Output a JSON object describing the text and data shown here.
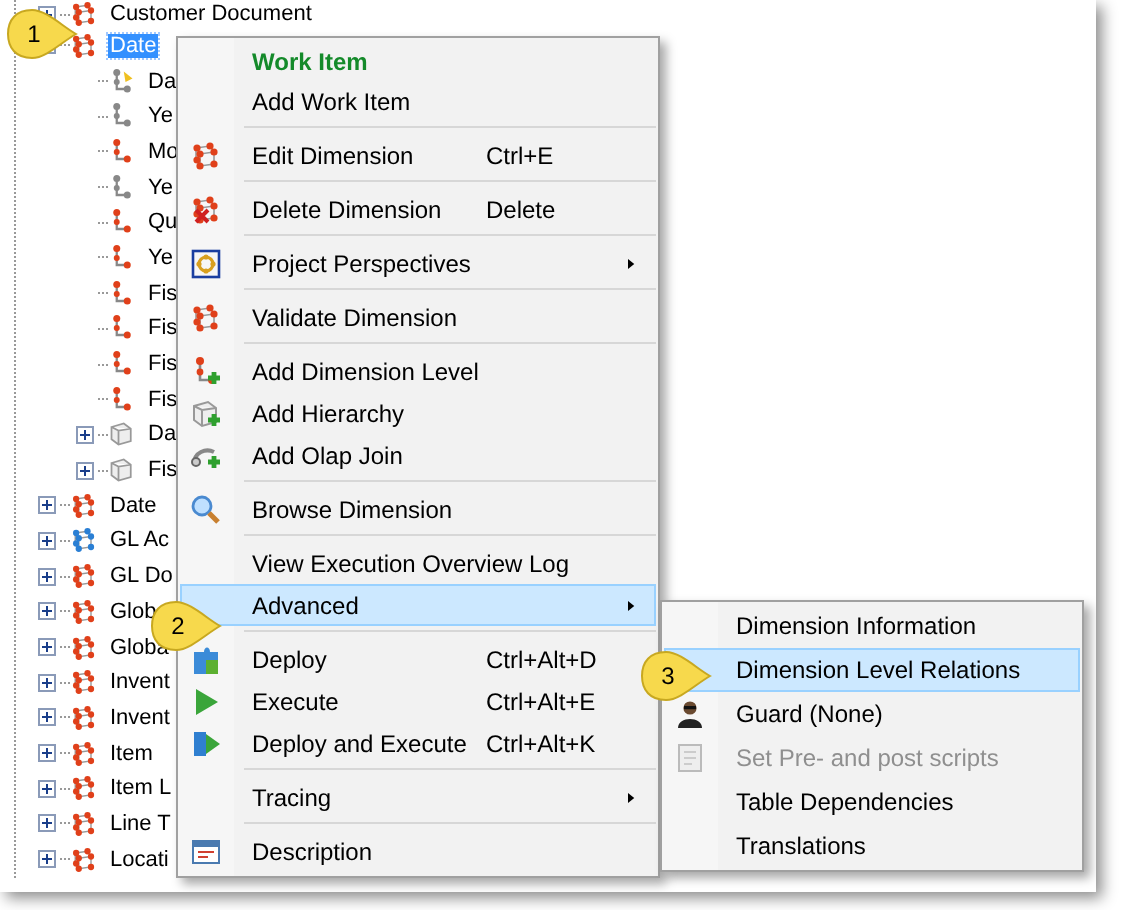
{
  "tree": [
    {
      "label": "Customer Document",
      "kind": "dimension",
      "expanded": false,
      "selected": false
    },
    {
      "label": "Date",
      "kind": "dimension",
      "expanded": true,
      "selected": true,
      "children": [
        {
          "label": "Da",
          "kind": "key-level",
          "expanded": false,
          "selected": false
        },
        {
          "label": "Ye",
          "kind": "grey-level",
          "expanded": false,
          "selected": false
        },
        {
          "label": "Mo",
          "kind": "level",
          "expanded": false,
          "selected": false
        },
        {
          "label": "Ye",
          "kind": "grey-level",
          "expanded": false,
          "selected": false
        },
        {
          "label": "Qu",
          "kind": "level",
          "expanded": false,
          "selected": false
        },
        {
          "label": "Ye",
          "kind": "level",
          "expanded": false,
          "selected": false
        },
        {
          "label": "Fis",
          "kind": "level",
          "expanded": false,
          "selected": false
        },
        {
          "label": "Fis",
          "kind": "level",
          "expanded": false,
          "selected": false
        },
        {
          "label": "Fis",
          "kind": "level",
          "expanded": false,
          "selected": false
        },
        {
          "label": "Fis",
          "kind": "level",
          "expanded": false,
          "selected": false
        },
        {
          "label": "Da",
          "kind": "hierarchy",
          "expanded": false,
          "selected": false
        },
        {
          "label": "Fis",
          "kind": "hierarchy",
          "expanded": false,
          "selected": false
        }
      ]
    },
    {
      "label": "Date",
      "kind": "dimension",
      "expanded": false,
      "selected": false
    },
    {
      "label": "GL Ac",
      "kind": "linked-dimension",
      "expanded": false,
      "selected": false
    },
    {
      "label": "GL Do",
      "kind": "dimension",
      "expanded": false,
      "selected": false
    },
    {
      "label": "Glob",
      "kind": "dimension",
      "expanded": false,
      "selected": false
    },
    {
      "label": "Globa",
      "kind": "dimension",
      "expanded": false,
      "selected": false
    },
    {
      "label": "Invent",
      "kind": "dimension",
      "expanded": false,
      "selected": false
    },
    {
      "label": "Invent",
      "kind": "dimension",
      "expanded": false,
      "selected": false
    },
    {
      "label": "Item",
      "kind": "dimension",
      "expanded": false,
      "selected": false
    },
    {
      "label": "Item L",
      "kind": "dimension",
      "expanded": false,
      "selected": false
    },
    {
      "label": "Line T",
      "kind": "dimension",
      "expanded": false,
      "selected": false
    },
    {
      "label": "Locati",
      "kind": "dimension",
      "expanded": false,
      "selected": false
    }
  ],
  "context_menu": {
    "groups": [
      [
        {
          "label": "Work Item",
          "kind": "header",
          "selected": false,
          "has_submenu": false
        },
        {
          "label": "Add Work Item",
          "kind": "item",
          "selected": false,
          "has_submenu": false
        }
      ],
      [
        {
          "label": "Edit Dimension",
          "shortcut": "Ctrl+E",
          "kind": "item",
          "selected": false,
          "has_submenu": false
        }
      ],
      [
        {
          "label": "Delete Dimension",
          "shortcut": "Delete",
          "kind": "item",
          "selected": false,
          "has_submenu": false
        }
      ],
      [
        {
          "label": "Project Perspectives",
          "kind": "item",
          "selected": false,
          "has_submenu": true
        }
      ],
      [
        {
          "label": "Validate Dimension",
          "kind": "item",
          "selected": false,
          "has_submenu": false
        }
      ],
      [
        {
          "label": "Add Dimension Level",
          "kind": "item",
          "selected": false,
          "has_submenu": false
        },
        {
          "label": "Add Hierarchy",
          "kind": "item",
          "selected": false,
          "has_submenu": false
        },
        {
          "label": "Add Olap Join",
          "kind": "item",
          "selected": false,
          "has_submenu": false
        }
      ],
      [
        {
          "label": "Browse Dimension",
          "kind": "item",
          "selected": false,
          "has_submenu": false
        }
      ],
      [
        {
          "label": "View Execution Overview Log",
          "kind": "item",
          "selected": false,
          "has_submenu": false
        },
        {
          "label": "Advanced",
          "kind": "item",
          "selected": true,
          "has_submenu": true
        }
      ],
      [
        {
          "label": "Deploy",
          "shortcut": "Ctrl+Alt+D",
          "kind": "item",
          "selected": false,
          "has_submenu": false
        },
        {
          "label": "Execute",
          "shortcut": "Ctrl+Alt+E",
          "kind": "item",
          "selected": false,
          "has_submenu": false
        },
        {
          "label": "Deploy and Execute",
          "shortcut": "Ctrl+Alt+K",
          "kind": "item",
          "selected": false,
          "has_submenu": false
        }
      ],
      [
        {
          "label": "Tracing",
          "kind": "item",
          "selected": false,
          "has_submenu": true
        }
      ],
      [
        {
          "label": "Description",
          "kind": "item",
          "selected": false,
          "has_submenu": false
        }
      ]
    ]
  },
  "submenu": {
    "items": [
      {
        "label": "Dimension Information",
        "selected": false,
        "disabled": false
      },
      {
        "label": "Dimension Level Relations",
        "selected": true,
        "disabled": false
      },
      {
        "label": "Guard (None)",
        "selected": false,
        "disabled": false
      },
      {
        "label": "Set Pre- and post scripts",
        "selected": false,
        "disabled": true
      },
      {
        "label": "Table Dependencies",
        "selected": false,
        "disabled": false
      },
      {
        "label": "Translations",
        "selected": false,
        "disabled": false
      }
    ]
  },
  "callouts": [
    {
      "label": "1"
    },
    {
      "label": "2"
    },
    {
      "label": "3"
    }
  ]
}
